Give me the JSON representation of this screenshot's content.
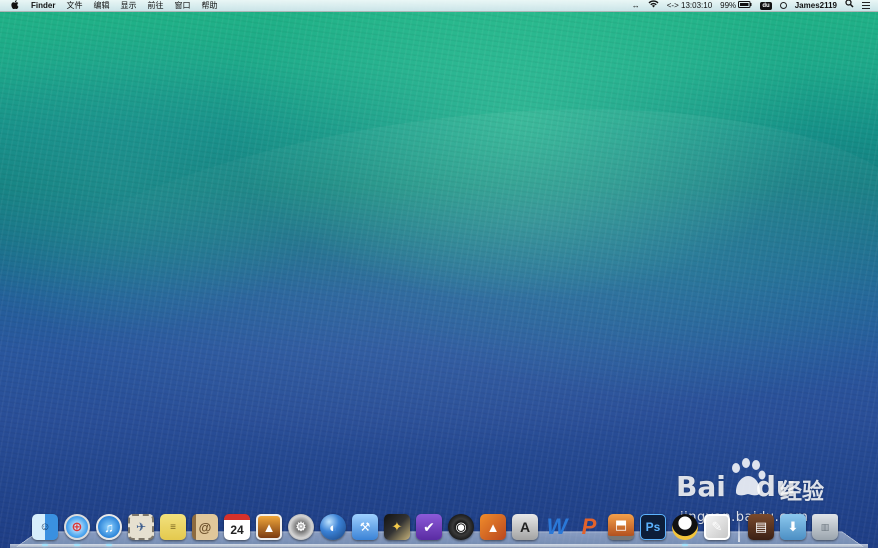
{
  "menubar": {
    "apple_icon": "apple-logo-icon",
    "app_name": "Finder",
    "menus": [
      "文件",
      "编辑",
      "显示",
      "前往",
      "窗口",
      "帮助"
    ],
    "status": {
      "arrows_icon": "↔",
      "wifi_icon": "wifi-icon",
      "time": "13:03:10",
      "time_prefix": "<->",
      "battery": "99%",
      "du_badge": "du",
      "user": "James2119"
    }
  },
  "watermark": {
    "logo": "Bai",
    "logo_suffix": "du",
    "cn": "经验",
    "url": "jingyan.baidu.com"
  },
  "dock": {
    "items": [
      {
        "name": "finder",
        "glyph": "☺",
        "running": true
      },
      {
        "name": "safari",
        "glyph": "⊕",
        "running": true
      },
      {
        "name": "itunes",
        "glyph": "♫",
        "running": true
      },
      {
        "name": "mail-stamp",
        "glyph": "✈",
        "running": false
      },
      {
        "name": "notes",
        "glyph": "≡",
        "running": false
      },
      {
        "name": "contacts",
        "glyph": "@",
        "running": false
      },
      {
        "name": "calendar",
        "glyph": "24",
        "running": false
      },
      {
        "name": "photo",
        "glyph": "▲",
        "running": false
      },
      {
        "name": "prefs",
        "glyph": "⚙",
        "running": false
      },
      {
        "name": "earth",
        "glyph": "◐",
        "running": false
      },
      {
        "name": "xcode",
        "glyph": "⚒",
        "running": false
      },
      {
        "name": "fcp",
        "glyph": "✦",
        "running": false
      },
      {
        "name": "omni",
        "glyph": "✔",
        "running": false
      },
      {
        "name": "aperture",
        "glyph": "◉",
        "running": false
      },
      {
        "name": "matlab",
        "glyph": "▲",
        "running": false
      },
      {
        "name": "autocad",
        "glyph": "A",
        "running": false
      },
      {
        "name": "word",
        "glyph": "W",
        "running": false
      },
      {
        "name": "ppt",
        "glyph": "P",
        "running": false
      },
      {
        "name": "keynote",
        "glyph": "⬒",
        "running": false
      },
      {
        "name": "ps",
        "glyph": "Ps",
        "running": false
      },
      {
        "name": "qq",
        "glyph": "",
        "running": true
      },
      {
        "name": "preview",
        "glyph": "✎",
        "running": false
      }
    ],
    "right_items": [
      {
        "name": "folder1",
        "glyph": "▤",
        "running": false
      },
      {
        "name": "folder2",
        "glyph": "⬇",
        "running": false
      },
      {
        "name": "trash",
        "glyph": "▥",
        "running": false
      }
    ]
  }
}
